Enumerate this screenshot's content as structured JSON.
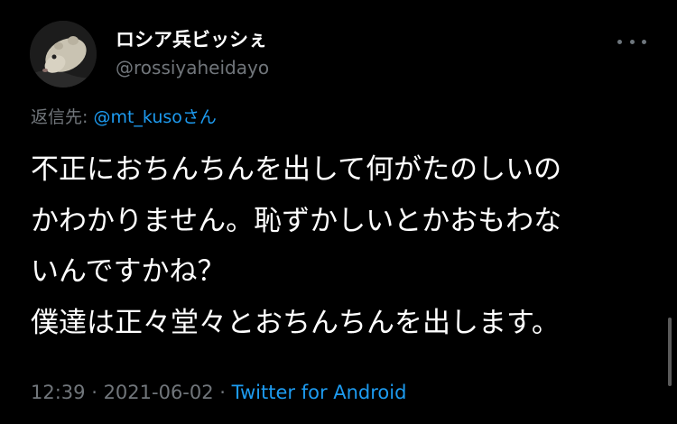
{
  "tweet": {
    "author": {
      "display_name": "ロシア兵ビッシぇ",
      "handle": "@rossiyaheidayo",
      "avatar_icon": "hamster-avatar-photo"
    },
    "reply": {
      "prefix": "返信先: ",
      "to_handle": "@mt_kuso",
      "suffix": "さん"
    },
    "body_lines": [
      "不正におちんちんを出して何がたのしいの",
      "かわかりません。恥ずかしいとかおもわな",
      "いんですかね？",
      "僕達は正々堂々とおちんちんを出します。"
    ],
    "time": "12:39",
    "separator": " · ",
    "date": "2021-06-02",
    "source": "Twitter for Android"
  },
  "colors": {
    "background": "#000000",
    "text": "#ffffff",
    "secondary": "#71767b",
    "accent": "#1d9bf0"
  },
  "icons": {
    "more": "more-horizontal-icon"
  }
}
